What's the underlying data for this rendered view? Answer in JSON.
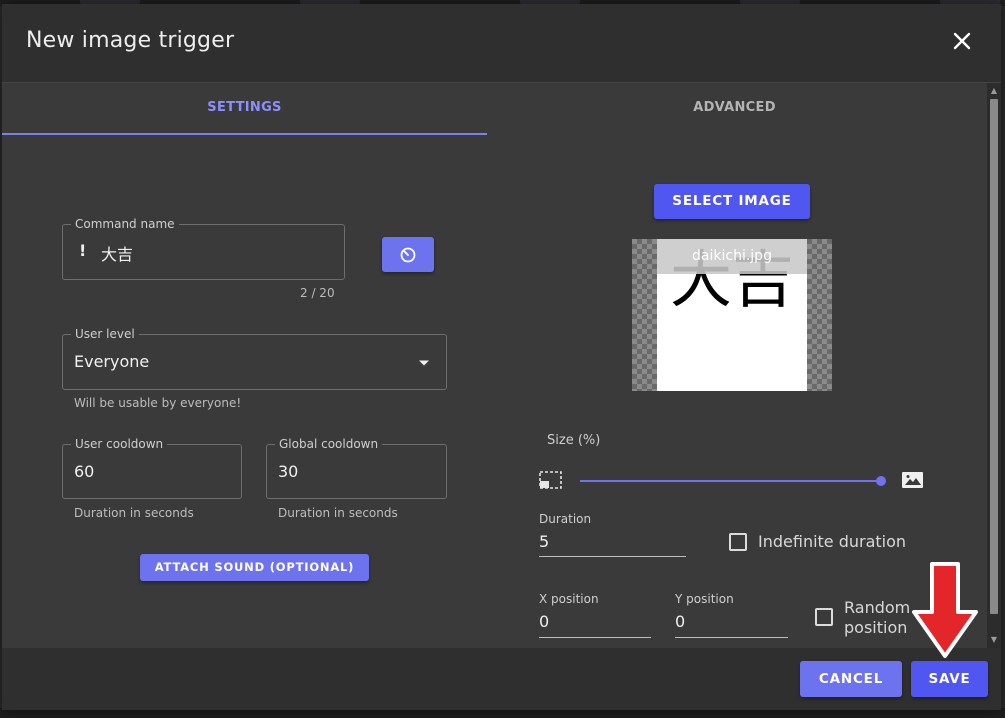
{
  "dialog": {
    "title": "New image trigger",
    "close_icon": "close-icon"
  },
  "tabs": [
    {
      "label": "SETTINGS",
      "active": true
    },
    {
      "label": "ADVANCED",
      "active": false
    }
  ],
  "settings": {
    "command_name": {
      "legend": "Command name",
      "prefix": "!",
      "value": "大吉",
      "counter": "2 / 20",
      "timer_button_icon": "timer-icon"
    },
    "user_level": {
      "legend": "User level",
      "value": "Everyone",
      "helper": "Will be usable by everyone!"
    },
    "user_cooldown": {
      "legend": "User cooldown",
      "value": "60",
      "helper": "Duration in seconds"
    },
    "global_cooldown": {
      "legend": "Global cooldown",
      "value": "30",
      "helper": "Duration in seconds"
    },
    "attach_sound_label": "ATTACH SOUND (OPTIONAL)"
  },
  "image": {
    "select_label": "SELECT IMAGE",
    "file_name": "daikichi.jpg",
    "preview_text": "大吉",
    "size_label": "Size (%)",
    "size_value": 100,
    "duration": {
      "label": "Duration",
      "value": "5"
    },
    "indefinite_label": "Indefinite duration",
    "indefinite_checked": false,
    "x_position": {
      "label": "X position",
      "value": "0"
    },
    "y_position": {
      "label": "Y position",
      "value": "0"
    },
    "random_label_1": "Random",
    "random_label_2": "position",
    "random_checked": false
  },
  "footer": {
    "cancel_label": "CANCEL",
    "save_label": "SAVE"
  },
  "colors": {
    "accent": "#5057f0",
    "tab_active": "#8b90ff",
    "annotation_arrow": "#e3262a"
  }
}
